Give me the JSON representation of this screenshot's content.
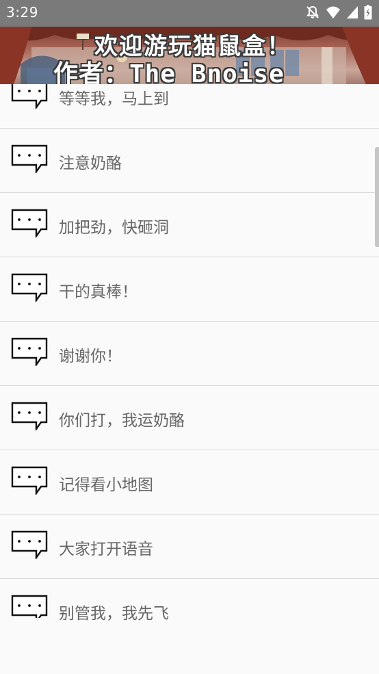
{
  "status_bar": {
    "time": "3:29",
    "icons": [
      "notifications-off-icon",
      "wifi-icon",
      "cell-signal-icon",
      "battery-icon"
    ]
  },
  "banner": {
    "line1": "欢迎游玩猫鼠盒！",
    "line2": "作者：The_Bnoise"
  },
  "messages": [
    {
      "label": "等等我，马上到"
    },
    {
      "label": "注意奶酪"
    },
    {
      "label": "加把劲，快砸洞"
    },
    {
      "label": "干的真棒！"
    },
    {
      "label": "谢谢你！"
    },
    {
      "label": "你们打，我运奶酪"
    },
    {
      "label": "记得看小地图"
    },
    {
      "label": "大家打开语音"
    },
    {
      "label": "别管我，我先飞"
    }
  ],
  "colors": {
    "status_bar": "#7a7a7a",
    "background": "#fafafa",
    "label_text": "#666666",
    "divider": "#d9d9d9"
  }
}
